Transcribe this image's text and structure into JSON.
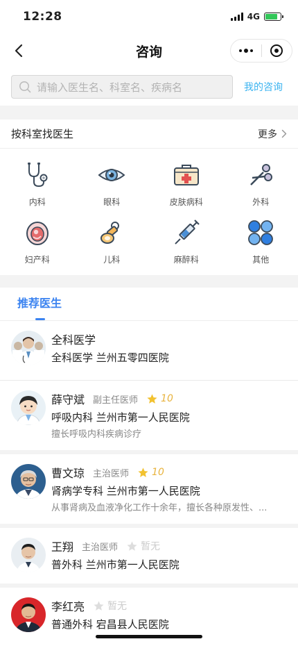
{
  "status": {
    "time": "12:28",
    "network": "4G"
  },
  "nav": {
    "title": "咨询"
  },
  "search": {
    "placeholder": "请输入医生名、科室名、疾病名",
    "my_consult": "我的咨询"
  },
  "departments": {
    "title": "按科室找医生",
    "more": "更多",
    "items": [
      {
        "label": "内科",
        "icon": "stethoscope-icon"
      },
      {
        "label": "眼科",
        "icon": "eye-icon"
      },
      {
        "label": "皮肤病科",
        "icon": "medical-kit-icon"
      },
      {
        "label": "外科",
        "icon": "scissors-icon"
      },
      {
        "label": "妇产科",
        "icon": "pregnancy-icon"
      },
      {
        "label": "儿科",
        "icon": "pacifier-icon"
      },
      {
        "label": "麻醉科",
        "icon": "syringe-icon"
      },
      {
        "label": "其他",
        "icon": "clover-icon"
      }
    ]
  },
  "recommend": {
    "tab": "推荐医生"
  },
  "doctors": [
    {
      "name": "全科医学",
      "title": "",
      "rating": "",
      "dept": "全科医学",
      "hospital": "兰州五零四医院",
      "desc": ""
    },
    {
      "name": "薛守斌",
      "title": "副主任医师",
      "rating": "10",
      "dept": "呼吸内科",
      "hospital": "兰州市第一人民医院",
      "desc": "擅长呼吸内科疾病诊疗"
    },
    {
      "name": "曹文琼",
      "title": "主治医师",
      "rating": "10",
      "dept": "肾病学专科",
      "hospital": "兰州市第一人民医院",
      "desc": "从事肾病及血液净化工作十余年，擅长各种原发性、..."
    },
    {
      "name": "王翔",
      "title": "主治医师",
      "rating": "暂无",
      "dept": "普外科",
      "hospital": "兰州市第一人民医院",
      "desc": ""
    },
    {
      "name": "李红亮",
      "title": "",
      "rating": "暂无",
      "dept": "普通外科",
      "hospital": "宕昌县人民医院",
      "desc": ""
    }
  ],
  "colors": {
    "accent": "#3b83f0",
    "link": "#3ab3f0",
    "star": "#f2c230"
  }
}
